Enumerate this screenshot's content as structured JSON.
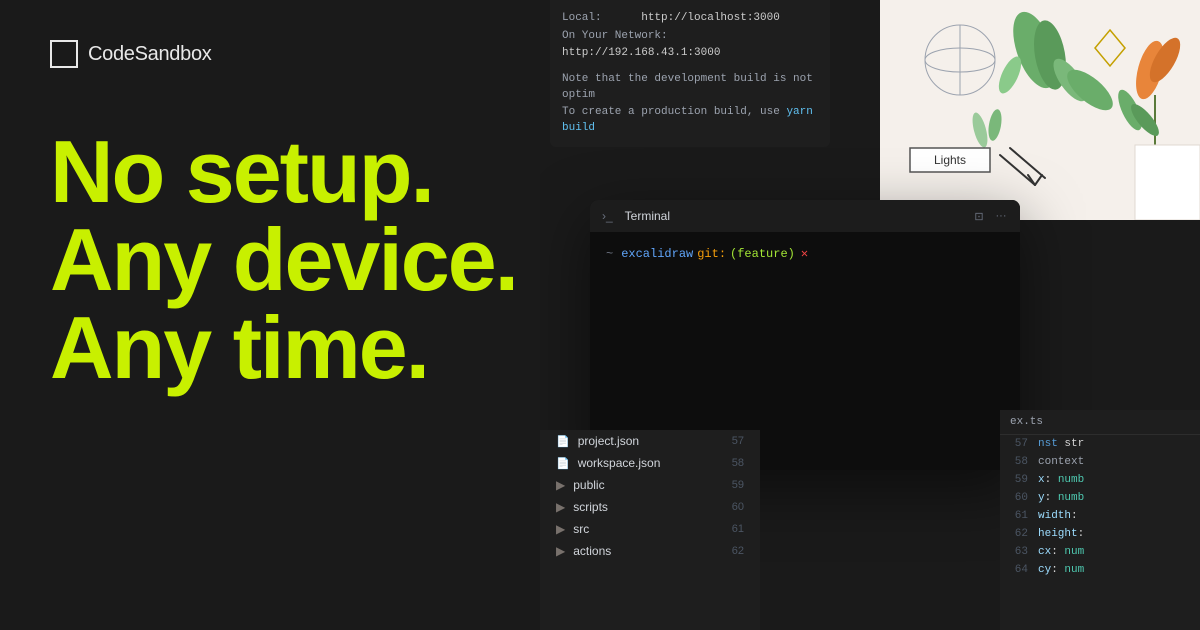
{
  "logo": {
    "text": "CodeSandbox"
  },
  "hero": {
    "line1": "No setup.",
    "line2": "Any device.",
    "line3": "Any time."
  },
  "server_output": {
    "local_label": "Local:",
    "local_url": "http://localhost:3000",
    "network_label": "On Your Network:",
    "network_url": "http://192.168.43.1:3000",
    "note_line1": "Note that the development build is not optim",
    "note_line2": "To create a production build, use",
    "yarn_cmd": "yarn build"
  },
  "terminal": {
    "title": "Terminal",
    "prompt_tilde": "~",
    "prompt_dir": "excalidraw",
    "prompt_git_label": "git:",
    "prompt_branch": "(feature)",
    "prompt_x": "✕"
  },
  "design_panel": {
    "label_box": "Lights"
  },
  "file_explorer": {
    "items": [
      {
        "type": "file",
        "name": "project.json",
        "line": "57"
      },
      {
        "type": "file",
        "name": "workspace.json",
        "line": "58"
      },
      {
        "type": "folder",
        "name": "public",
        "line": "59"
      },
      {
        "type": "folder",
        "name": "scripts",
        "line": "60"
      },
      {
        "type": "folder",
        "name": "src",
        "line": "61"
      },
      {
        "type": "folder",
        "name": "actions",
        "line": "62"
      }
    ]
  },
  "code_panel": {
    "filename": "ex.ts",
    "lines": [
      {
        "num": "57",
        "content": "nst str",
        "type": "keyword"
      },
      {
        "num": "58",
        "content": "context",
        "type": "normal"
      },
      {
        "num": "59",
        "content": "x: numb",
        "type": "type"
      },
      {
        "num": "60",
        "content": "y: numb",
        "type": "type"
      },
      {
        "num": "61",
        "content": "width:",
        "type": "type"
      },
      {
        "num": "62",
        "content": "height:",
        "type": "type"
      },
      {
        "num": "63",
        "content": "cx: num",
        "type": "type"
      },
      {
        "num": "64",
        "content": "cy: num",
        "type": "type"
      }
    ]
  },
  "colors": {
    "hero_text": "#c8f000",
    "background": "#1a1a1a",
    "terminal_bg": "#0d0d0d",
    "panel_bg": "#1e1e1e"
  }
}
